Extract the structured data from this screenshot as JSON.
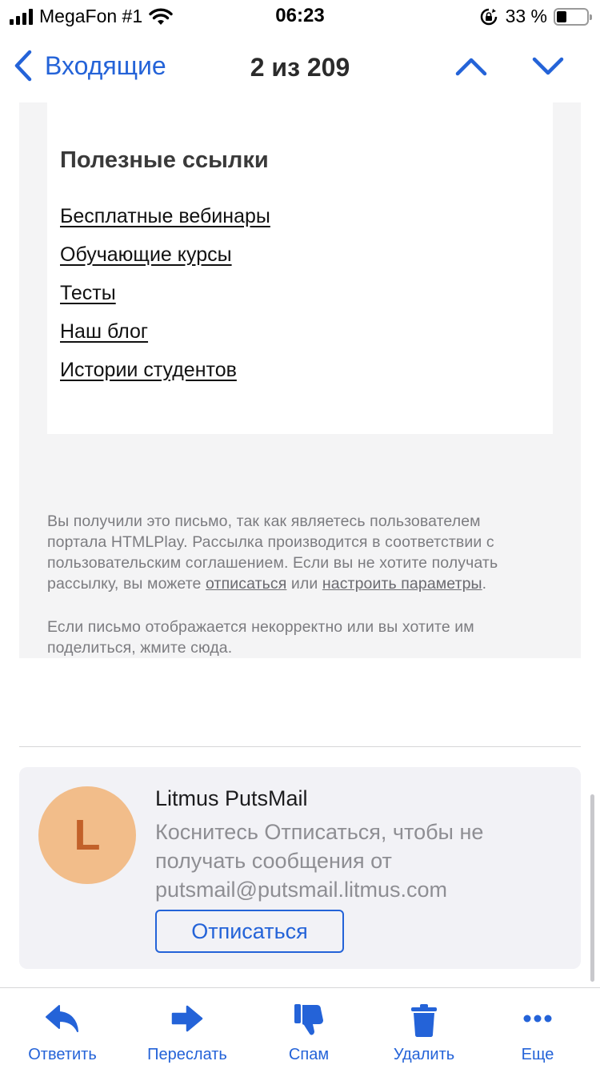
{
  "status_bar": {
    "carrier": "MegaFon #1",
    "time": "06:23",
    "battery_percent": "33 %",
    "battery_level": 0.33,
    "icons": [
      "signal-icon",
      "wifi-icon",
      "rotation-lock-icon",
      "battery-icon"
    ]
  },
  "nav": {
    "back_label": "Входящие",
    "title": "2 из 209",
    "icons": [
      "chevron-left-icon",
      "chevron-up-icon",
      "chevron-down-icon"
    ]
  },
  "email": {
    "links_title": "Полезные ссылки",
    "links": [
      "Бесплатные вебинары",
      "Обучающие курсы",
      "Тесты",
      "Наш блог",
      "Истории студентов"
    ],
    "footer": {
      "line1": "Вы получили это письмо, так как являетесь пользователем",
      "line2": "портала HTMLPlay. Рассылка производится в соответствии с",
      "line3": "пользовательским соглашением. Если вы не хотите получать",
      "line4_pre": "рассылку, вы можете ",
      "unsubscribe_link": "отписаться",
      "line4_mid": " или ",
      "settings_link": "настроить параметры",
      "line4_post": ".",
      "share_line1": "Если письмо отображается некорректно или вы хотите им",
      "share_line2": "поделиться, жмите сюда."
    }
  },
  "unsubscribe_banner": {
    "avatar_letter": "L",
    "sender": "Litmus PutsMail",
    "message_line1": "Коснитесь Отписаться, чтобы не",
    "message_line2": "получать сообщения от",
    "message_line3": "putsmail@putsmail.litmus.com",
    "button_label": "Отписаться"
  },
  "toolbar": {
    "reply": "Ответить",
    "forward": "Переслать",
    "spam": "Спам",
    "delete": "Удалить",
    "more": "Еще"
  },
  "colors": {
    "accent": "#2463d8",
    "avatar_bg": "#f2bd8a",
    "avatar_letter": "#c2612a",
    "mail_background": "#f4f4f5"
  }
}
